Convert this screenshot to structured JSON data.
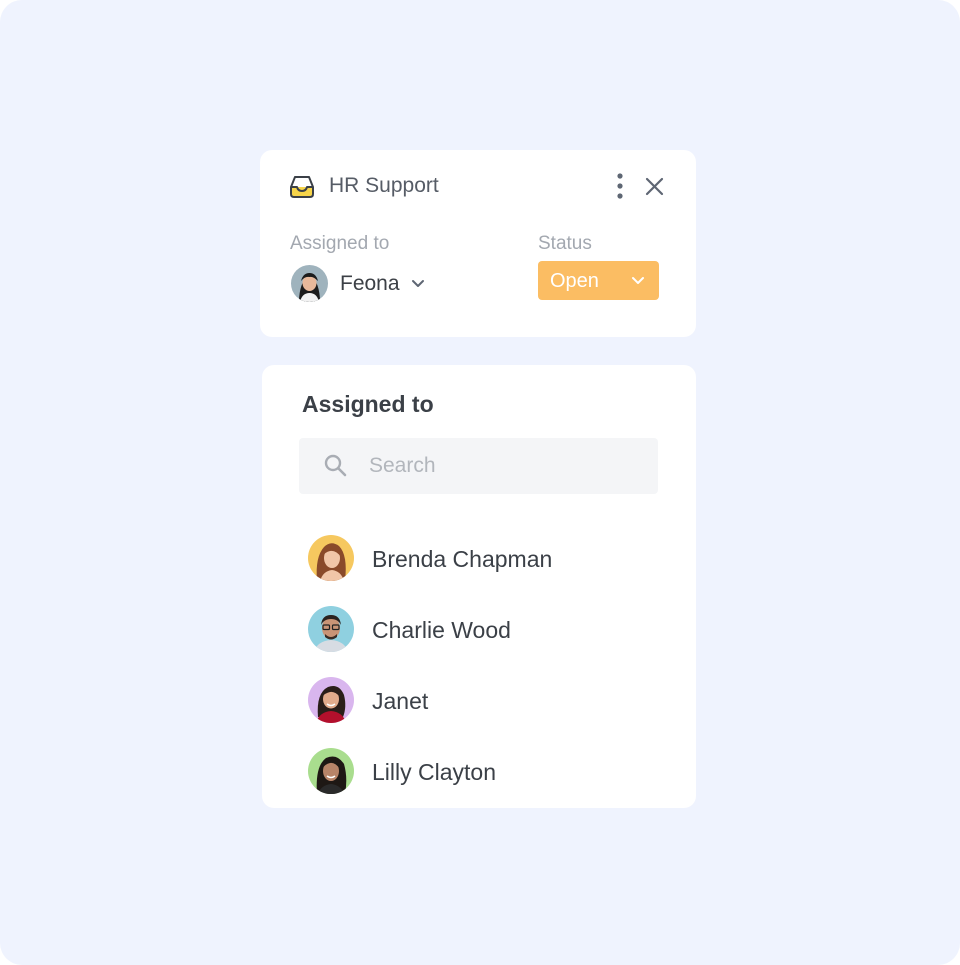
{
  "ticket": {
    "title": "HR Support",
    "inbox_icon": "inbox-tray-icon",
    "more_icon": "more-vertical-icon",
    "close_icon": "close-icon",
    "assigned_label": "Assigned to",
    "assignee": {
      "name": "Feona",
      "avatar_bg": "#9fb3bd"
    },
    "status_label": "Status",
    "status_value": "Open",
    "status_color": "#fbbd63"
  },
  "assign_panel": {
    "title": "Assigned to",
    "search_placeholder": "Search",
    "search_value": "",
    "people": [
      {
        "name": "Brenda Chapman",
        "avatar_bg": "#f6c85f"
      },
      {
        "name": "Charlie Wood",
        "avatar_bg": "#8fd0e0"
      },
      {
        "name": "Janet",
        "avatar_bg": "#d9b6ee"
      },
      {
        "name": "Lilly Clayton",
        "avatar_bg": "#a9dd8e"
      }
    ]
  },
  "colors": {
    "background": "#eff3fe",
    "card": "#ffffff",
    "accent_yellow": "#fbbd63",
    "icon_gray": "#6b7280"
  }
}
